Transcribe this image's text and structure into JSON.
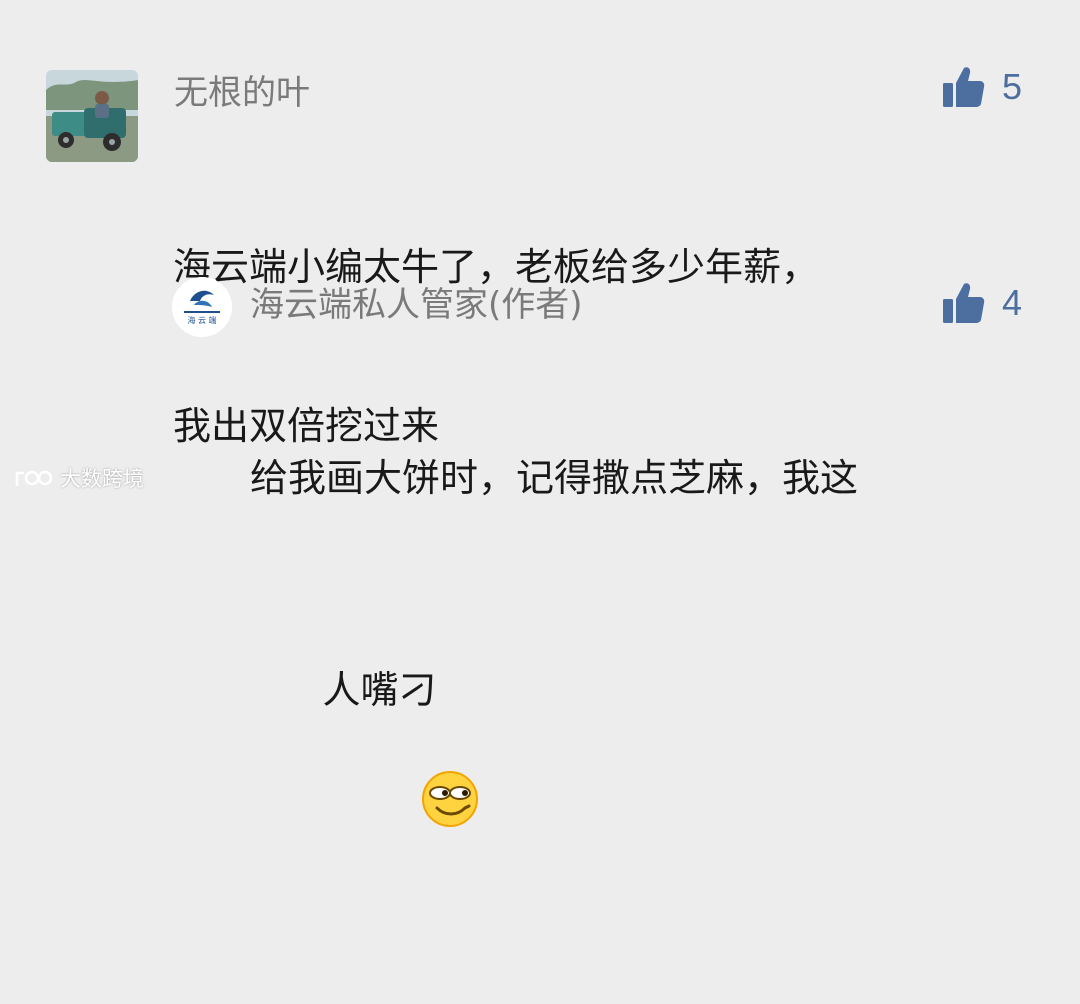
{
  "comments": [
    {
      "author": "无根的叶",
      "text_line1": "海云端小编太牛了，老板给多少年薪，",
      "text_line2": "我出双倍挖过来",
      "likes": "5"
    }
  ],
  "reply": {
    "author": "海云端私人管家(作者)",
    "text_line1": "给我画大饼时，记得撒点芝麻，我这",
    "text_line2": "人嘴刁",
    "likes": "4",
    "avatar_logo_text": "海 云 端"
  },
  "watermark": {
    "text": "大数跨境"
  },
  "colors": {
    "background": "#ededed",
    "name": "#7a7a7a",
    "text": "#191919",
    "like": "#4d6fa0"
  }
}
